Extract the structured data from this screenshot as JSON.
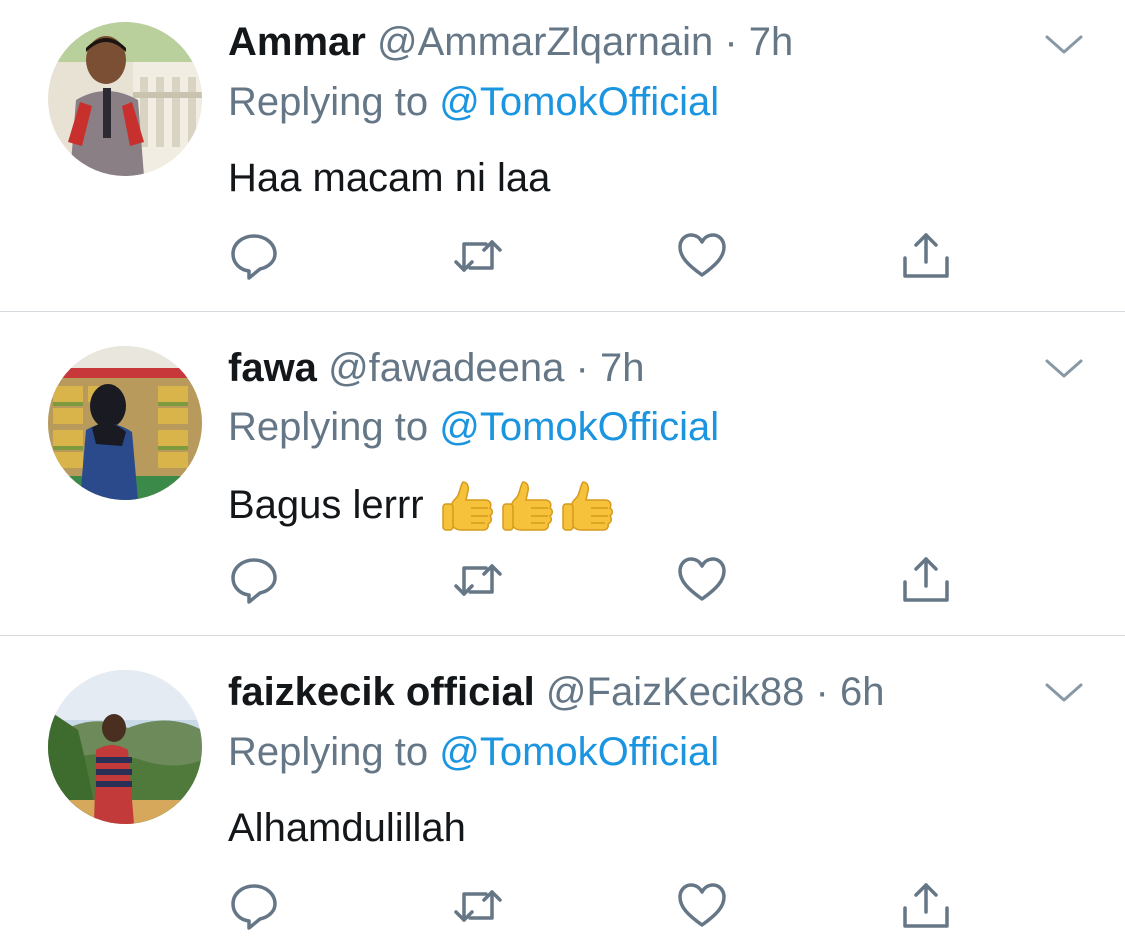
{
  "colors": {
    "text": "#14171a",
    "secondary": "#657786",
    "link": "#1b95e0",
    "icon": "#657786",
    "divider": "#d6dbdf"
  },
  "reply_prefix": "Replying to",
  "tweets": [
    {
      "name": "Ammar",
      "handle": "@AmmarZlqarnain",
      "separator": "·",
      "time": "7h",
      "replying_to": "@TomokOfficial",
      "text": "Haa macam ni laa",
      "emoji": []
    },
    {
      "name": "fawa",
      "handle": "@fawadeena",
      "separator": "·",
      "time": "7h",
      "replying_to": "@TomokOfficial",
      "text": "Bagus lerrr",
      "emoji": [
        "thumbs-up",
        "thumbs-up",
        "thumbs-up"
      ]
    },
    {
      "name": "faizkecik official",
      "handle": "@FaizKecik88",
      "separator": "·",
      "time": "6h",
      "replying_to": "@TomokOfficial",
      "text": "Alhamdulillah",
      "emoji": []
    }
  ],
  "icons": {
    "reply": "reply-bubble-icon",
    "retweet": "retweet-icon",
    "like": "heart-icon",
    "share": "share-icon",
    "menu": "chevron-down-icon"
  }
}
